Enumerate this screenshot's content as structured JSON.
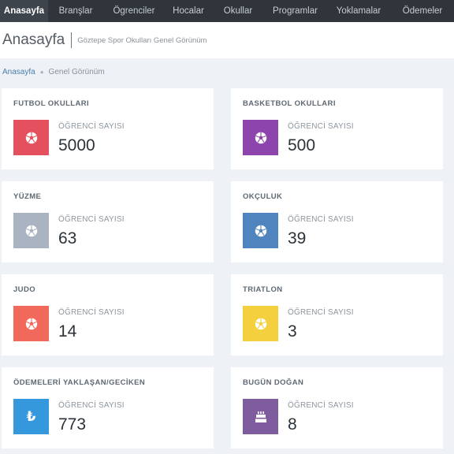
{
  "nav": {
    "items": [
      {
        "label": "Anasayfa",
        "active": true
      },
      {
        "label": "Branşlar",
        "active": false
      },
      {
        "label": "Ögrenciler",
        "active": false
      },
      {
        "label": "Hocalar",
        "active": false
      },
      {
        "label": "Okullar",
        "active": false
      },
      {
        "label": "Programlar",
        "active": false
      },
      {
        "label": "Yoklamalar",
        "active": false
      },
      {
        "label": "Ödemeler",
        "active": false
      }
    ]
  },
  "header": {
    "title": "Anasayfa",
    "subtitle": "Göztepe Spor Okulları Genel Görünüm"
  },
  "breadcrumb": {
    "home": "Anasayfa",
    "current": "Genel Görünüm"
  },
  "cards": [
    {
      "title": "FUTBOL OKULLARI",
      "label": "ÖĞRENCİ SAYISI",
      "value": "5000",
      "color": "#e5505f",
      "icon": "soccer-ball-icon"
    },
    {
      "title": "BASKETBOL OKULLARI",
      "label": "ÖĞRENCİ SAYISI",
      "value": "500",
      "color": "#8e44ad",
      "icon": "soccer-ball-icon"
    },
    {
      "title": "YÜZME",
      "label": "ÖĞRENCİ SAYISI",
      "value": "63",
      "color": "#a9b3c1",
      "icon": "soccer-ball-icon"
    },
    {
      "title": "OKÇULUK",
      "label": "ÖĞRENCİ SAYISI",
      "value": "39",
      "color": "#4f84bf",
      "icon": "soccer-ball-icon"
    },
    {
      "title": "JUDO",
      "label": "ÖĞRENCİ SAYISI",
      "value": "14",
      "color": "#f1695a",
      "icon": "soccer-ball-icon"
    },
    {
      "title": "TRIATLON",
      "label": "ÖĞRENCİ SAYISI",
      "value": "3",
      "color": "#f4d03f",
      "icon": "soccer-ball-icon"
    },
    {
      "title": "ÖDEMELERİ YAKLAŞAN/GECİKEN",
      "label": "ÖĞRENCİ SAYISI",
      "value": "773",
      "color": "#3598dc",
      "icon": "lira-icon",
      "icon_glyph": "₺"
    },
    {
      "title": "BUGÜN DOĞAN",
      "label": "ÖĞRENCİ SAYISI",
      "value": "8",
      "color": "#7e5c9e",
      "icon": "birthday-cake-icon"
    }
  ]
}
